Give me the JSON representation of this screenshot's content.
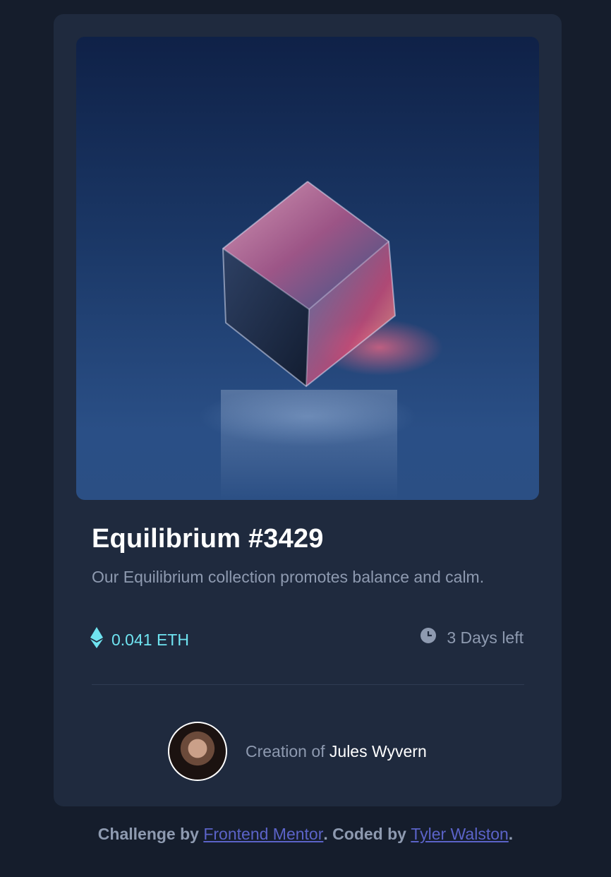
{
  "card": {
    "title": "Equilibrium #3429",
    "description": "Our Equilibrium collection promotes balance and calm.",
    "price": "0.041 ETH",
    "time_left": "3 Days left",
    "icons": {
      "price_icon": "ethereum-icon",
      "time_icon": "clock-icon"
    },
    "creator_prefix": "Creation of",
    "creator_name": "Jules Wyvern"
  },
  "footer": {
    "challenge_prefix": "Challenge by",
    "challenge_link": "Frontend Mentor",
    "middle": ". Coded by",
    "coded_link": "Tyler Walston",
    "suffix": "."
  },
  "colors": {
    "page_bg": "#151d2c",
    "card_bg": "#1f2a3e",
    "accent_cyan": "#6fe3f0",
    "muted_text": "#8e9ab0",
    "link": "#5b63c8"
  }
}
